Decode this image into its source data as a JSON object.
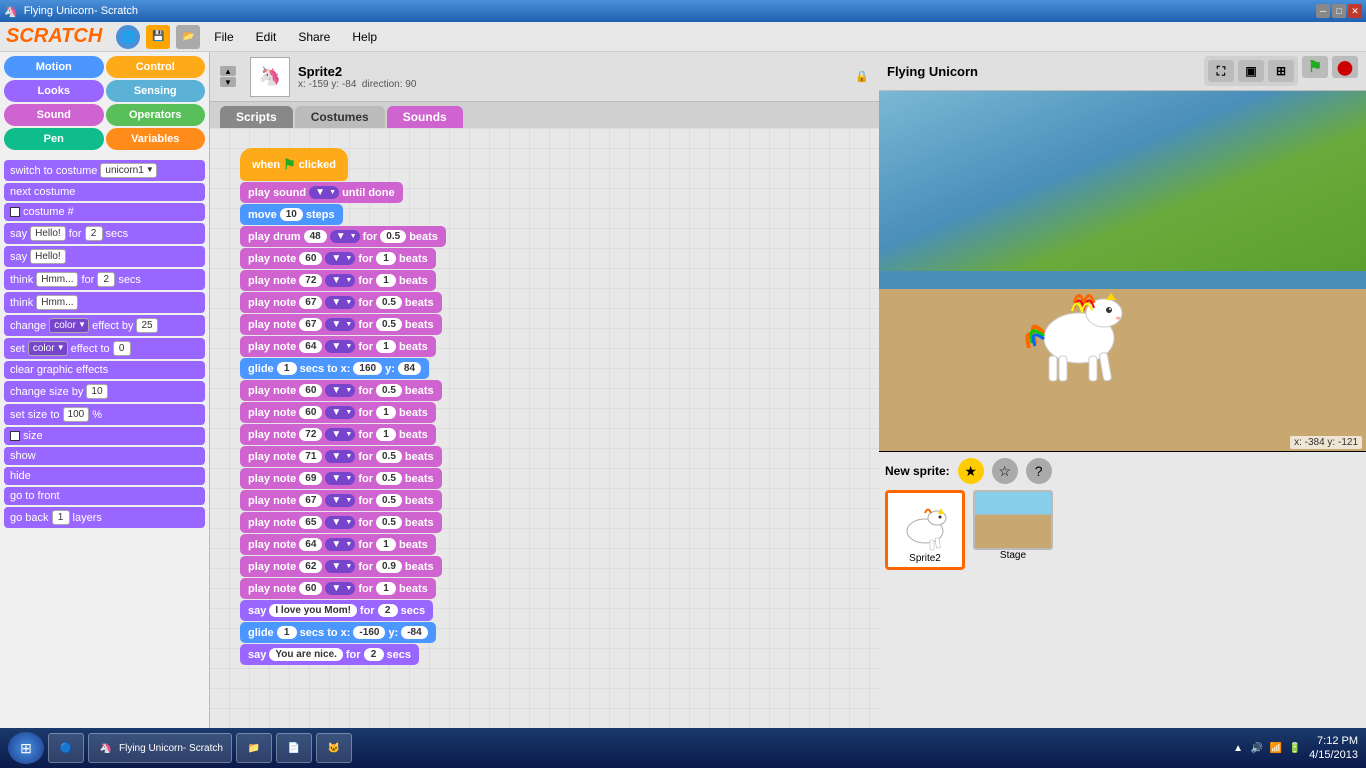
{
  "titlebar": {
    "title": "Flying Unicorn- Scratch",
    "min": "─",
    "max": "□",
    "close": "✕"
  },
  "menubar": {
    "file": "File",
    "edit": "Edit",
    "share": "Share",
    "help": "Help"
  },
  "categories": {
    "motion": "Motion",
    "control": "Control",
    "looks": "Looks",
    "sensing": "Sensing",
    "sound": "Sound",
    "operators": "Operators",
    "pen": "Pen",
    "variables": "Variables"
  },
  "blocks": [
    {
      "label": "switch to costume",
      "type": "purple",
      "has_dropdown": true,
      "dropdown_val": "unicorn1"
    },
    {
      "label": "next costume",
      "type": "purple"
    },
    {
      "label": "costume #",
      "type": "purple",
      "has_checkbox": true
    },
    {
      "label": "say Hello! for",
      "type": "purple",
      "input1": "2",
      "suffix": "secs"
    },
    {
      "label": "say Hello!",
      "type": "purple"
    },
    {
      "label": "think Hmm... for",
      "type": "purple",
      "input1": "2",
      "suffix": "secs"
    },
    {
      "label": "think Hmm...",
      "type": "purple"
    },
    {
      "label": "change",
      "type": "purple",
      "has_dropdown2": true,
      "dropdown_val2": "color",
      "suffix": "effect by",
      "input1": "25"
    },
    {
      "label": "set",
      "type": "purple",
      "has_dropdown2": true,
      "dropdown_val2": "color",
      "suffix": "effect to",
      "input1": "0"
    },
    {
      "label": "clear graphic effects",
      "type": "purple"
    },
    {
      "label": "change size by",
      "type": "purple",
      "input1": "10"
    },
    {
      "label": "set size to",
      "type": "purple",
      "input1": "100",
      "suffix": "%"
    },
    {
      "label": "size",
      "type": "purple",
      "has_checkbox": true
    },
    {
      "label": "show",
      "type": "purple"
    },
    {
      "label": "hide",
      "type": "purple"
    },
    {
      "label": "go to front",
      "type": "purple"
    },
    {
      "label": "go back",
      "type": "purple",
      "input1": "1",
      "suffix": "layers"
    }
  ],
  "sprite": {
    "name": "Sprite2",
    "x": "-159",
    "y": "-84",
    "direction": "90"
  },
  "tabs": {
    "scripts": "Scripts",
    "costumes": "Costumes",
    "sounds": "Sounds"
  },
  "script_blocks": [
    {
      "type": "hat",
      "label": "when",
      "flag": true,
      "suffix": "clicked"
    },
    {
      "type": "pink",
      "label": "play sound",
      "has_dropdown": true,
      "dropdown_val": "▼",
      "suffix": "until done"
    },
    {
      "type": "blue",
      "label": "move",
      "input1": "10",
      "suffix": "steps"
    },
    {
      "type": "pink",
      "label": "play drum",
      "input1": "48",
      "dropdown1": "▼",
      "suffix": "for",
      "input2": "0.5",
      "suffix2": "beats"
    },
    {
      "type": "pink",
      "label": "play note",
      "input1": "60",
      "dropdown1": "▼",
      "suffix": "for",
      "input2": "1",
      "suffix2": "beats"
    },
    {
      "type": "pink",
      "label": "play note",
      "input1": "72",
      "dropdown1": "▼",
      "suffix": "for",
      "input2": "1",
      "suffix2": "beats"
    },
    {
      "type": "pink",
      "label": "play note",
      "input1": "67",
      "dropdown1": "▼",
      "suffix": "for",
      "input2": "0.5",
      "suffix2": "beats"
    },
    {
      "type": "pink",
      "label": "play note",
      "input1": "67",
      "dropdown1": "▼",
      "suffix": "for",
      "input2": "0.5",
      "suffix2": "beats"
    },
    {
      "type": "pink",
      "label": "play note",
      "input1": "64",
      "dropdown1": "▼",
      "suffix": "for",
      "input2": "1",
      "suffix2": "beats"
    },
    {
      "type": "blue",
      "label": "glide",
      "input1": "1",
      "suffix": "secs to x:",
      "input2": "160",
      "suffix2": "y:",
      "input3": "84"
    },
    {
      "type": "pink",
      "label": "play note",
      "input1": "60",
      "dropdown1": "▼",
      "suffix": "for",
      "input2": "0.5",
      "suffix2": "beats"
    },
    {
      "type": "pink",
      "label": "play note",
      "input1": "60",
      "dropdown1": "▼",
      "suffix": "for",
      "input2": "1",
      "suffix2": "beats"
    },
    {
      "type": "pink",
      "label": "play note",
      "input1": "72",
      "dropdown1": "▼",
      "suffix": "for",
      "input2": "1",
      "suffix2": "beats"
    },
    {
      "type": "pink",
      "label": "play note",
      "input1": "71",
      "dropdown1": "▼",
      "suffix": "for",
      "input2": "0.5",
      "suffix2": "beats"
    },
    {
      "type": "pink",
      "label": "play note",
      "input1": "69",
      "dropdown1": "▼",
      "suffix": "for",
      "input2": "0.5",
      "suffix2": "beats"
    },
    {
      "type": "pink",
      "label": "play note",
      "input1": "67",
      "dropdown1": "▼",
      "suffix": "for",
      "input2": "0.5",
      "suffix2": "beats"
    },
    {
      "type": "pink",
      "label": "play note",
      "input1": "65",
      "dropdown1": "▼",
      "suffix": "for",
      "input2": "0.5",
      "suffix2": "beats"
    },
    {
      "type": "pink",
      "label": "play note",
      "input1": "64",
      "dropdown1": "▼",
      "suffix": "for",
      "input2": "1",
      "suffix2": "beats"
    },
    {
      "type": "pink",
      "label": "play note",
      "input1": "62",
      "dropdown1": "▼",
      "suffix": "for",
      "input2": "0.9",
      "suffix2": "beats"
    },
    {
      "type": "pink",
      "label": "play note",
      "input1": "60",
      "dropdown1": "▼",
      "suffix": "for",
      "input2": "1",
      "suffix2": "beats"
    },
    {
      "type": "purple",
      "label": "say",
      "input1": "I love you Mom!",
      "suffix": "for",
      "input2": "2",
      "suffix2": "secs"
    },
    {
      "type": "blue",
      "label": "glide",
      "input1": "1",
      "suffix": "secs to x:",
      "input2": "-160",
      "suffix2": "y:",
      "input3": "-84"
    },
    {
      "type": "purple",
      "label": "say",
      "input1": "You are nice.",
      "suffix": "for",
      "input2": "2",
      "suffix2": "secs"
    }
  ],
  "stage": {
    "title": "Flying Unicorn",
    "coords": "x: -384  y: -121"
  },
  "sprites": [
    {
      "name": "Sprite2",
      "selected": true
    },
    {
      "name": "Stage",
      "selected": false
    }
  ],
  "new_sprite_label": "New sprite:",
  "taskbar": {
    "time": "7:12 PM",
    "date": "4/15/2013"
  }
}
